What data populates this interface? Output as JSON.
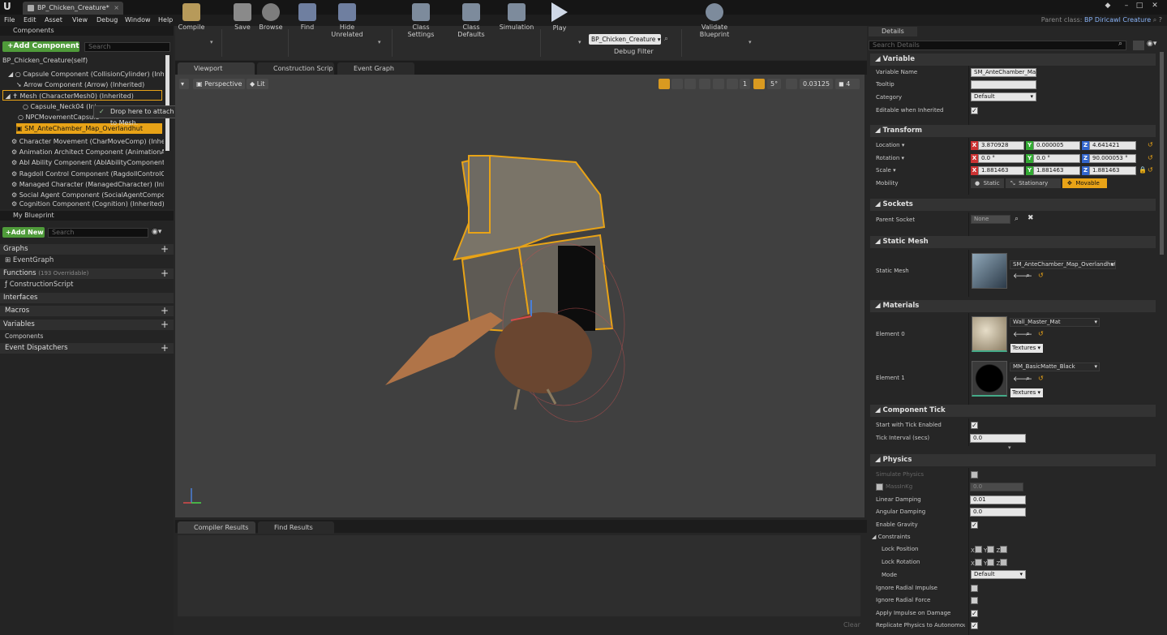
{
  "titlebar": {
    "tab": "BP_Chicken_Creature*"
  },
  "menu": [
    "File",
    "Edit",
    "Asset",
    "View",
    "Debug",
    "Window",
    "Help"
  ],
  "parent_class": {
    "label": "Parent class:",
    "value": "BP Diricawl Creature"
  },
  "components": {
    "title": "Components",
    "add_button": "+Add Component",
    "search_placeholder": "Search",
    "items": [
      "BP_Chicken_Creature(self)",
      "Capsule Component (CollisionCylinder) (Inherited)",
      "Arrow Component (Arrow) (Inherited)",
      "Mesh (CharacterMesh0) (Inherited)",
      "Capsule_Neck04 (Inh",
      "NPCMovementCapsule",
      "SM_AnteChamber_Map_Overlandhut",
      "Character Movement (CharMoveComp) (Inherited)",
      "Animation Architect Component (AnimationArchi",
      "Abl Ability Component (AblAbilityComponent) (Inh",
      "Ragdoll Control Component (RagdollControlComp",
      "Managed Character (ManagedCharacter) (Inherite",
      "Social Agent Component (SocialAgentComponent",
      "Cognition Component (Cognition) (Inherited)"
    ],
    "tooltip": "Drop here to attach SM_AnteChamber_Map_Overlandhut to Mesh."
  },
  "my_blueprint": {
    "title": "My Blueprint",
    "add_button": "+Add New",
    "search_placeholder": "Search",
    "graphs": "Graphs",
    "event_graph": "EventGraph",
    "functions": "Functions",
    "functions_count": "(193 Overridable)",
    "construction_script": "ConstructionScript",
    "interfaces": "Interfaces",
    "macros": "Macros",
    "variables": "Variables",
    "components": "Components",
    "event_dispatchers": "Event Dispatchers"
  },
  "toolbar": {
    "compile": "Compile",
    "save": "Save",
    "browse": "Browse",
    "find": "Find",
    "hide_unrelated": "Hide Unrelated",
    "class_settings": "Class Settings",
    "class_defaults": "Class Defaults",
    "simulation": "Simulation",
    "play": "Play",
    "debug_object": "BP_Chicken_Creature",
    "debug_filter": "Debug Filter",
    "validate": "Validate Blueprint"
  },
  "editor_tabs": {
    "viewport": "Viewport",
    "construction": "Construction Scrip",
    "event_graph": "Event Graph"
  },
  "viewport": {
    "perspective": "Perspective",
    "lit": "Lit",
    "grid_snap": "1",
    "angle_snap": "5°",
    "scale_snap": "0.03125",
    "camera_speed": "4"
  },
  "bottom_tabs": {
    "compiler": "Compiler Results",
    "find": "Find Results",
    "clear": "Clear"
  },
  "details": {
    "title": "Details",
    "search_placeholder": "Search Details",
    "variable": {
      "section": "Variable",
      "name_label": "Variable Name",
      "name_value": "SM_AnteChamber_Map",
      "tooltip_label": "Tooltip",
      "category_label": "Category",
      "category_value": "Default",
      "editable_label": "Editable when Inherited"
    },
    "transform": {
      "section": "Transform",
      "location_label": "Location",
      "location": [
        "3.870928",
        "0.000005",
        "4.641421"
      ],
      "rotation_label": "Rotation",
      "rotation": [
        "0.0 °",
        "0.0 °",
        "90.000053 °"
      ],
      "scale_label": "Scale",
      "scale": [
        "1.881463",
        "1.881463",
        "1.881463"
      ],
      "mobility_label": "Mobility",
      "mobility": [
        "Static",
        "Stationary",
        "Movable"
      ]
    },
    "sockets": {
      "section": "Sockets",
      "parent_label": "Parent Socket",
      "parent_value": "None"
    },
    "static_mesh": {
      "section": "Static Mesh",
      "label": "Static Mesh",
      "value": "SM_AnteChamber_Map_Overlandhut"
    },
    "materials": {
      "section": "Materials",
      "e0_label": "Element 0",
      "e0_value": "Wall_Master_Mat",
      "e1_label": "Element 1",
      "e1_value": "MM_BasicMatte_Black",
      "textures": "Textures"
    },
    "tick": {
      "section": "Component Tick",
      "start_label": "Start with Tick Enabled",
      "interval_label": "Tick Interval (secs)",
      "interval_value": "0.0"
    },
    "physics": {
      "section": "Physics",
      "simulate": "Simulate Physics",
      "mass": "MassInKg",
      "mass_value": "0.0",
      "linear": "Linear Damping",
      "linear_value": "0.01",
      "angular": "Angular Damping",
      "angular_value": "0.0",
      "gravity": "Enable Gravity",
      "constraints": "Constraints",
      "lock_pos": "Lock Position",
      "lock_rot": "Lock Rotation",
      "mode": "Mode",
      "mode_value": "Default",
      "radial_impulse": "Ignore Radial Impulse",
      "radial_force": "Ignore Radial Force",
      "apply_impulse": "Apply Impulse on Damage",
      "replicate": "Replicate Physics to Autonomous P"
    }
  }
}
